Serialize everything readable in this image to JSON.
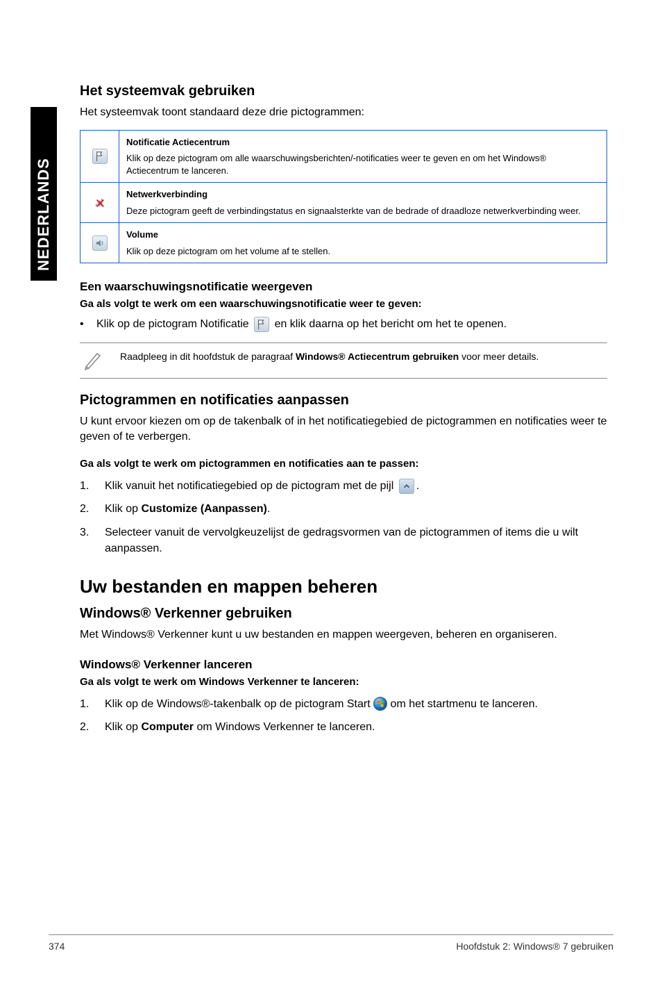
{
  "sideTab": "NEDERLANDS",
  "s1": {
    "title": "Het systeemvak gebruiken",
    "intro": "Het systeemvak toont standaard deze drie pictogrammen:",
    "rows": [
      {
        "title": "Notificatie Actiecentrum",
        "desc": "Klik op deze pictogram om alle waarschuwingsberichten/-notificaties weer te geven en om het Windows® Actiecentrum te lanceren."
      },
      {
        "title": "Netwerkverbinding",
        "desc": "Deze pictogram geeft de verbindingstatus en signaalsterkte van de bedrade of draadloze netwerkverbinding weer."
      },
      {
        "title": "Volume",
        "desc": "Klik op deze pictogram om het volume af te stellen."
      }
    ]
  },
  "s2": {
    "title": "Een waarschuwingsnotificatie weergeven",
    "lead": "Ga als volgt te werk om een waarschuwingsnotificatie weer te geven:",
    "bullet_a": "Klik op de pictogram Notificatie ",
    "bullet_b": " en klik daarna op het bericht om het te openen.",
    "note_a": "Raadpleeg in dit hoofdstuk de paragraaf ",
    "note_bold": "Windows® Actiecentrum gebruiken",
    "note_b": " voor meer details."
  },
  "s3": {
    "title": "Pictogrammen en notificaties aanpassen",
    "intro": "U kunt ervoor kiezen om op de takenbalk of in het notificatiegebied de pictogrammen en notificaties weer te geven of te verbergen.",
    "lead": "Ga als volgt te werk om pictogrammen en notificaties aan te passen:",
    "steps": {
      "s1a": "Klik vanuit het notificatiegebied op de pictogram met de pijl ",
      "s1b": ".",
      "s2a": "Klik op ",
      "s2bold": "Customize (Aanpassen)",
      "s2b": ".",
      "s3": "Selecteer vanuit de vervolgkeuzelijst de gedragsvormen van de pictogrammen of items die u wilt aanpassen."
    }
  },
  "s4": {
    "title": "Uw bestanden en mappen beheren",
    "sub1": "Windows® Verkenner gebruiken",
    "sub1_text": "Met Windows® Verkenner kunt u uw bestanden en mappen weergeven, beheren en organiseren.",
    "sub2": "Windows® Verkenner lanceren",
    "sub2_lead": "Ga als volgt te werk om Windows Verkenner te lanceren:",
    "steps": {
      "s1a": "Klik op de Windows®-takenbalk op de pictogram Start ",
      "s1b": " om het startmenu te lanceren.",
      "s2a": "Klik op ",
      "s2bold": "Computer",
      "s2b": " om Windows Verkenner te lanceren."
    }
  },
  "footer": {
    "page": "374",
    "chapter": "Hoofdstuk 2: Windows® 7 gebruiken"
  }
}
